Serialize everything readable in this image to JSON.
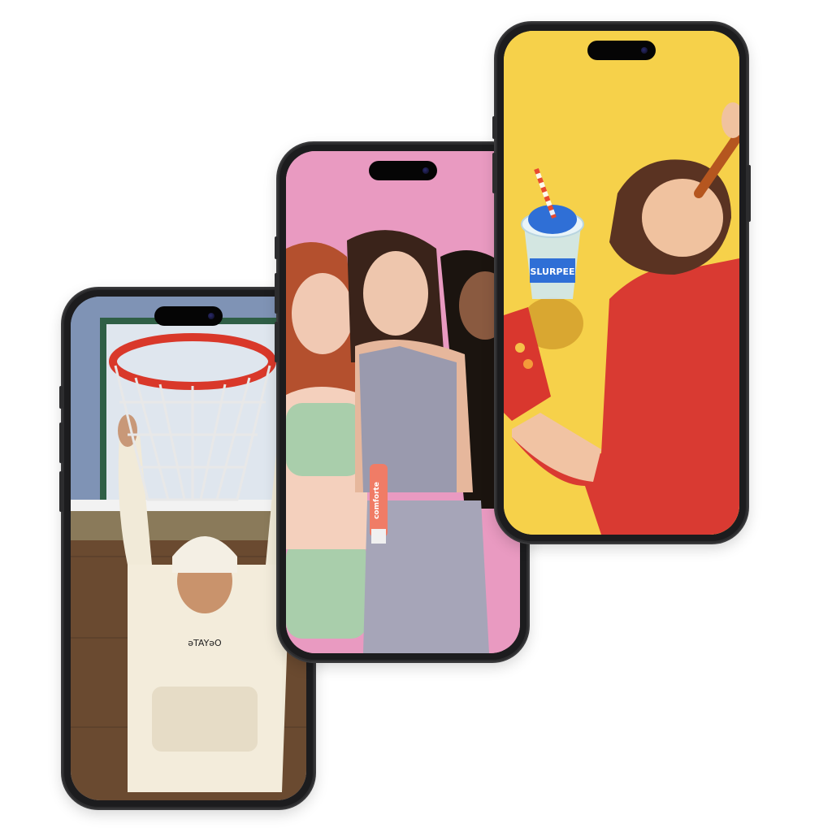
{
  "phones": [
    {
      "id": "phone-basketball",
      "scene": "basketball hoop hang",
      "hoodie_text": "əTAYǝO"
    },
    {
      "id": "phone-pink",
      "scene": "three women with product tube",
      "product_text": "comforte"
    },
    {
      "id": "phone-yellow",
      "scene": "man eating snack with slush drink",
      "cup_text": "SLURPEE"
    }
  ],
  "colors": {
    "phone_frame": "#1c1c1e",
    "pink_bg": "#e99ac1",
    "yellow_bg": "#f6d14a",
    "hoop_red": "#d9382a",
    "sweater_red": "#d93a32"
  }
}
